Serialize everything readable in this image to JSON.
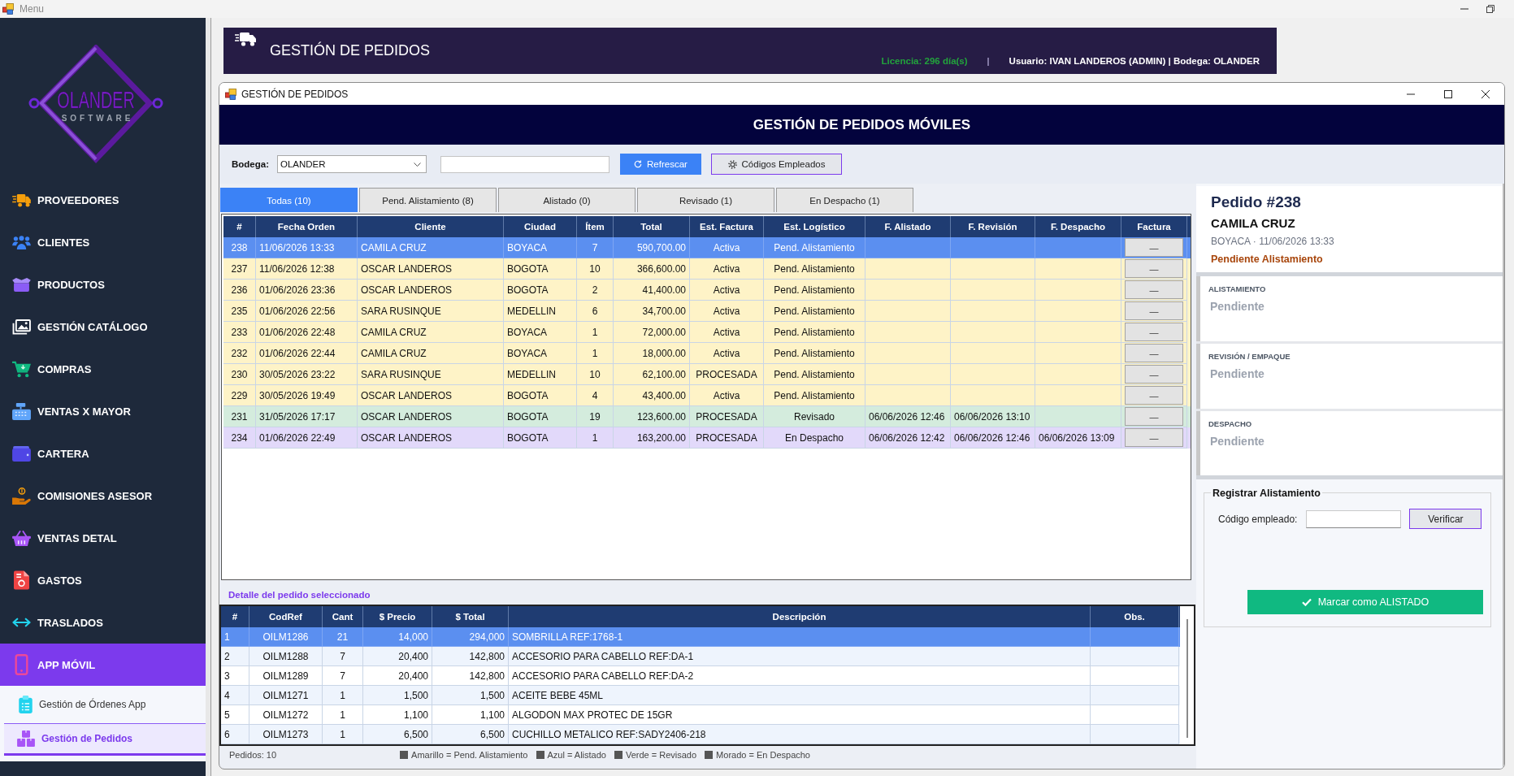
{
  "window": {
    "title": "Menu"
  },
  "sidebar": {
    "logo": {
      "name": "OLANDER",
      "tagline": "SOFTWARE"
    },
    "items": [
      {
        "label": "PROVEEDORES",
        "selected": false
      },
      {
        "label": "CLIENTES",
        "selected": false
      },
      {
        "label": "PRODUCTOS",
        "selected": false
      },
      {
        "label": "GESTIÓN CATÁLOGO",
        "selected": false
      },
      {
        "label": "COMPRAS",
        "selected": false
      },
      {
        "label": "VENTAS X MAYOR",
        "selected": false
      },
      {
        "label": "CARTERA",
        "selected": false
      },
      {
        "label": "COMISIONES ASESOR",
        "selected": false
      },
      {
        "label": "VENTAS DETAL",
        "selected": false
      },
      {
        "label": "GASTOS",
        "selected": false
      },
      {
        "label": "TRASLADOS",
        "selected": false
      },
      {
        "label": "APP MÓVIL",
        "selected": true,
        "children": [
          {
            "label": "Gestión de Órdenes App",
            "selected": false
          },
          {
            "label": "Gestión de Pedidos",
            "selected": true
          }
        ]
      }
    ]
  },
  "header": {
    "title": "GESTIÓN DE PEDIDOS",
    "license": "Licencia: 296 día(s)",
    "separator": "|",
    "user": "Usuario: IVAN LANDEROS (ADMIN) | Bodega: OLANDER"
  },
  "child_window": {
    "title": "GESTIÓN DE PEDIDOS",
    "banner": "GESTIÓN DE PEDIDOS MÓVILES"
  },
  "toolbar": {
    "warehouse_label": "Bodega:",
    "warehouse": "OLANDER",
    "refresh_button": "Refrescar",
    "codes_button": "Códigos Empleados"
  },
  "tabs": [
    {
      "label": "Todas (10)",
      "selected": true
    },
    {
      "label": "Pend. Alistamiento (8)",
      "selected": false
    },
    {
      "label": "Alistado (0)",
      "selected": false
    },
    {
      "label": "Revisado (1)",
      "selected": false
    },
    {
      "label": "En Despacho (1)",
      "selected": false
    }
  ],
  "orders": {
    "columns": [
      "#",
      "Fecha Orden",
      "Cliente",
      "Ciudad",
      "Ítem",
      "Total",
      "Est. Factura",
      "Est. Logístico",
      "F. Alistado",
      "F. Revisión",
      "F. Despacho",
      "Factura"
    ],
    "rows": [
      {
        "number": "238",
        "date": "11/06/2026 13:33",
        "client": "CAMILA CRUZ",
        "city": "BOYACA",
        "items": "7",
        "total": "590,700.00",
        "invoice_status": "Activa",
        "logistics_status": "Pend. Alistamiento",
        "invoice": "—",
        "selected": true
      },
      {
        "number": "237",
        "date": "11/06/2026 12:38",
        "client": "OSCAR LANDEROS",
        "city": "BOGOTA",
        "items": "10",
        "total": "366,600.00",
        "invoice_status": "Activa",
        "logistics_status": "Pend. Alistamiento",
        "invoice": "—",
        "selected": false,
        "color": "#fef3c7"
      },
      {
        "number": "236",
        "date": "01/06/2026 23:36",
        "client": "OSCAR LANDEROS",
        "city": "BOGOTA",
        "items": "2",
        "total": "41,400.00",
        "invoice_status": "Activa",
        "logistics_status": "Pend. Alistamiento",
        "invoice": "—",
        "selected": false,
        "color": "#fef3c7"
      },
      {
        "number": "235",
        "date": "01/06/2026 22:56",
        "client": "SARA RUSINQUE",
        "city": "MEDELLIN",
        "items": "6",
        "total": "34,700.00",
        "invoice_status": "Activa",
        "logistics_status": "Pend. Alistamiento",
        "invoice": "—",
        "selected": false,
        "color": "#fef3c7"
      },
      {
        "number": "233",
        "date": "01/06/2026 22:48",
        "client": "CAMILA CRUZ",
        "city": "BOYACA",
        "items": "1",
        "total": "72,000.00",
        "invoice_status": "Activa",
        "logistics_status": "Pend. Alistamiento",
        "invoice": "—",
        "selected": false,
        "color": "#fef3c7"
      },
      {
        "number": "232",
        "date": "01/06/2026 22:44",
        "client": "CAMILA CRUZ",
        "city": "BOYACA",
        "items": "1",
        "total": "18,000.00",
        "invoice_status": "Activa",
        "logistics_status": "Pend. Alistamiento",
        "invoice": "—",
        "selected": false,
        "color": "#fef3c7"
      },
      {
        "number": "230",
        "date": "30/05/2026 23:22",
        "client": "SARA RUSINQUE",
        "city": "MEDELLIN",
        "items": "10",
        "total": "62,100.00",
        "invoice_status": "PROCESADA",
        "logistics_status": "Pend. Alistamiento",
        "invoice": "—",
        "selected": false,
        "color": "#fef3c7"
      },
      {
        "number": "229",
        "date": "30/05/2026 19:49",
        "client": "OSCAR LANDEROS",
        "city": "BOGOTA",
        "items": "4",
        "total": "43,400.00",
        "invoice_status": "Activa",
        "logistics_status": "Pend. Alistamiento",
        "invoice": "—",
        "selected": false,
        "color": "#fef3c7"
      },
      {
        "number": "231",
        "date": "31/05/2026 17:17",
        "client": "OSCAR LANDEROS",
        "city": "BOGOTA",
        "items": "19",
        "total": "123,600.00",
        "invoice_status": "PROCESADA",
        "logistics_status": "Revisado",
        "ready_at": "06/06/2026 12:46",
        "reviewed_at": "06/06/2026 13:10",
        "invoice": "—",
        "selected": false,
        "color": "#d4ecdd"
      },
      {
        "number": "234",
        "date": "01/06/2026 22:49",
        "client": "OSCAR LANDEROS",
        "city": "BOGOTA",
        "items": "1",
        "total": "163,200.00",
        "invoice_status": "PROCESADA",
        "logistics_status": "En Despacho",
        "ready_at": "06/06/2026 12:42",
        "reviewed_at": "06/06/2026 12:46",
        "dispatched_at": "06/06/2026 13:09",
        "invoice": "—",
        "selected": false,
        "color": "#e2d9fa"
      }
    ]
  },
  "detail": {
    "title": "Detalle del pedido seleccionado",
    "columns": [
      "#",
      "CodRef",
      "Cant",
      "$ Precio",
      "$ Total",
      "Descripción",
      "Obs."
    ],
    "rows": [
      {
        "number": "1",
        "code": "OILM1286",
        "qty": "21",
        "price": "14,000",
        "total": "294,000",
        "description": "SOMBRILLA REF:1768-1",
        "selected": true
      },
      {
        "number": "2",
        "code": "OILM1288",
        "qty": "7",
        "price": "20,400",
        "total": "142,800",
        "description": "ACCESORIO PARA CABELLO REF:DA-1",
        "selected": false
      },
      {
        "number": "3",
        "code": "OILM1289",
        "qty": "7",
        "price": "20,400",
        "total": "142,800",
        "description": "ACCESORIO PARA CABELLO REF:DA-2",
        "selected": false
      },
      {
        "number": "4",
        "code": "OILM1271",
        "qty": "1",
        "price": "1,500",
        "total": "1,500",
        "description": "ACEITE BEBE 45ML",
        "selected": false
      },
      {
        "number": "5",
        "code": "OILM1272",
        "qty": "1",
        "price": "1,100",
        "total": "1,100",
        "description": "ALGODON MAX PROTEC DE 15GR",
        "selected": false
      },
      {
        "number": "6",
        "code": "OILM1273",
        "qty": "1",
        "price": "6,500",
        "total": "6,500",
        "description": "CUCHILLO METALICO REF:SADY2406-218",
        "selected": false
      }
    ]
  },
  "status_bar": {
    "count": "Pedidos: 10",
    "legend": [
      "Amarillo = Pend. Alistamiento",
      "Azul = Alistado",
      "Verde = Revisado",
      "Morado = En Despacho"
    ]
  },
  "order_panel": {
    "title": "Pedido #238",
    "client": "CAMILA CRUZ",
    "meta": "BOYACA · 11/06/2026 13:33",
    "status": "Pendiente Alistamiento",
    "stages": [
      {
        "label": "ALISTAMIENTO",
        "value": "Pendiente",
        "done": false
      },
      {
        "label": "REVISIÓN / EMPAQUE",
        "value": "Pendiente",
        "done": false
      },
      {
        "label": "DESPACHO",
        "value": "Pendiente",
        "done": false
      }
    ],
    "register": {
      "title": "Registrar Alistamiento",
      "code_label": "Código empleado:",
      "verify_button": "Verificar",
      "mark_button": "Marcar como ALISTADO"
    }
  }
}
